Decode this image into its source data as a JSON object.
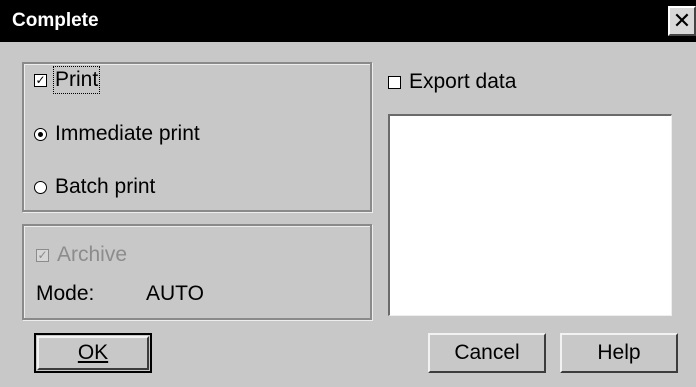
{
  "window": {
    "title": "Complete",
    "close_glyph": "✕"
  },
  "print_group": {
    "print_checkbox": {
      "label": "Print",
      "checked": true
    },
    "immediate_radio": {
      "label": "Immediate print",
      "selected": true
    },
    "batch_radio": {
      "label": "Batch print",
      "selected": false
    }
  },
  "archive_group": {
    "archive_checkbox": {
      "label": "Archive",
      "checked": true,
      "enabled": false
    },
    "mode_label": "Mode:",
    "mode_value": "AUTO"
  },
  "export": {
    "label": "Export data",
    "checked": false,
    "list_items": []
  },
  "buttons": {
    "ok": "OK",
    "cancel": "Cancel",
    "help": "Help"
  }
}
